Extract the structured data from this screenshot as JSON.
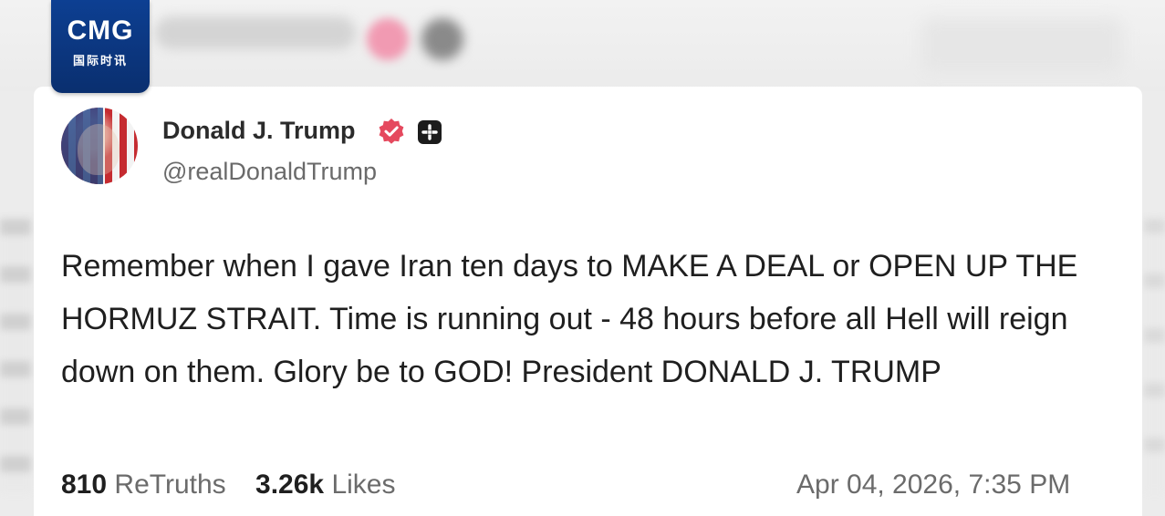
{
  "logo": {
    "brand": "CMG",
    "subtitle": "国际时讯"
  },
  "post": {
    "display_name": "Donald J. Trump",
    "handle": "@realDonaldTrump",
    "verified_icon": "verified-check-icon",
    "plus_icon": "plus-badge-icon",
    "text": "Remember when I gave Iran ten days to MAKE A DEAL or OPEN UP THE HORMUZ STRAIT. Time is running out - 48 hours before all Hell will reign down on them. Glory be to GOD! President DONALD J. TRUMP",
    "retruths_count": "810",
    "retruths_label": "ReTruths",
    "likes_count": "3.26k",
    "likes_label": "Likes",
    "timestamp": "Apr 04, 2026, 7:35 PM"
  },
  "colors": {
    "verified_badge": "#e5495e",
    "logo_blue": "#0d3f92",
    "text": "#1f1f1f",
    "muted": "#6b6b6b"
  }
}
